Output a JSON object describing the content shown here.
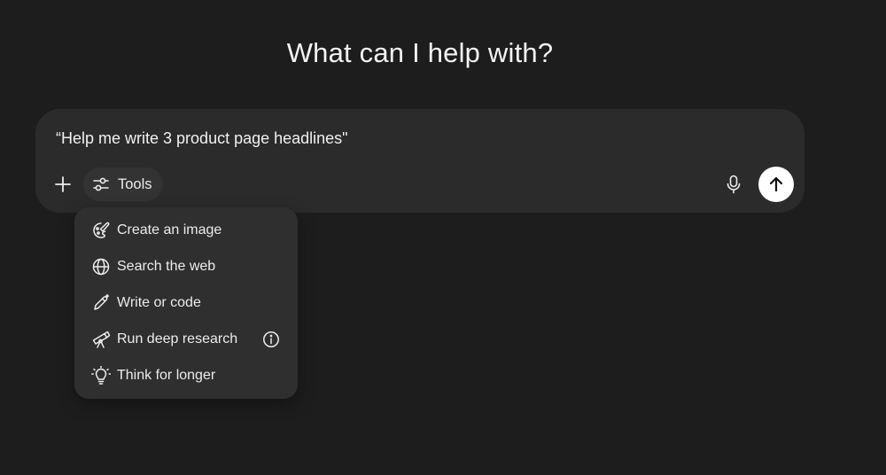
{
  "heading": "What can I help with?",
  "composer": {
    "prompt_text": "“Help me write 3 product page headlines\"",
    "tools_label": "Tools"
  },
  "menu": {
    "items": [
      {
        "label": "Create an image",
        "icon": "image-brush-icon"
      },
      {
        "label": "Search the web",
        "icon": "globe-icon"
      },
      {
        "label": "Write or code",
        "icon": "pencil-sparkle-icon"
      },
      {
        "label": "Run deep research",
        "icon": "telescope-icon"
      },
      {
        "label": "Think for longer",
        "icon": "lightbulb-icon"
      }
    ]
  },
  "colors": {
    "background": "#1d1d1d",
    "composer": "#2b2b2b",
    "menu": "#2f2f2f",
    "send_button": "#ffffff"
  }
}
